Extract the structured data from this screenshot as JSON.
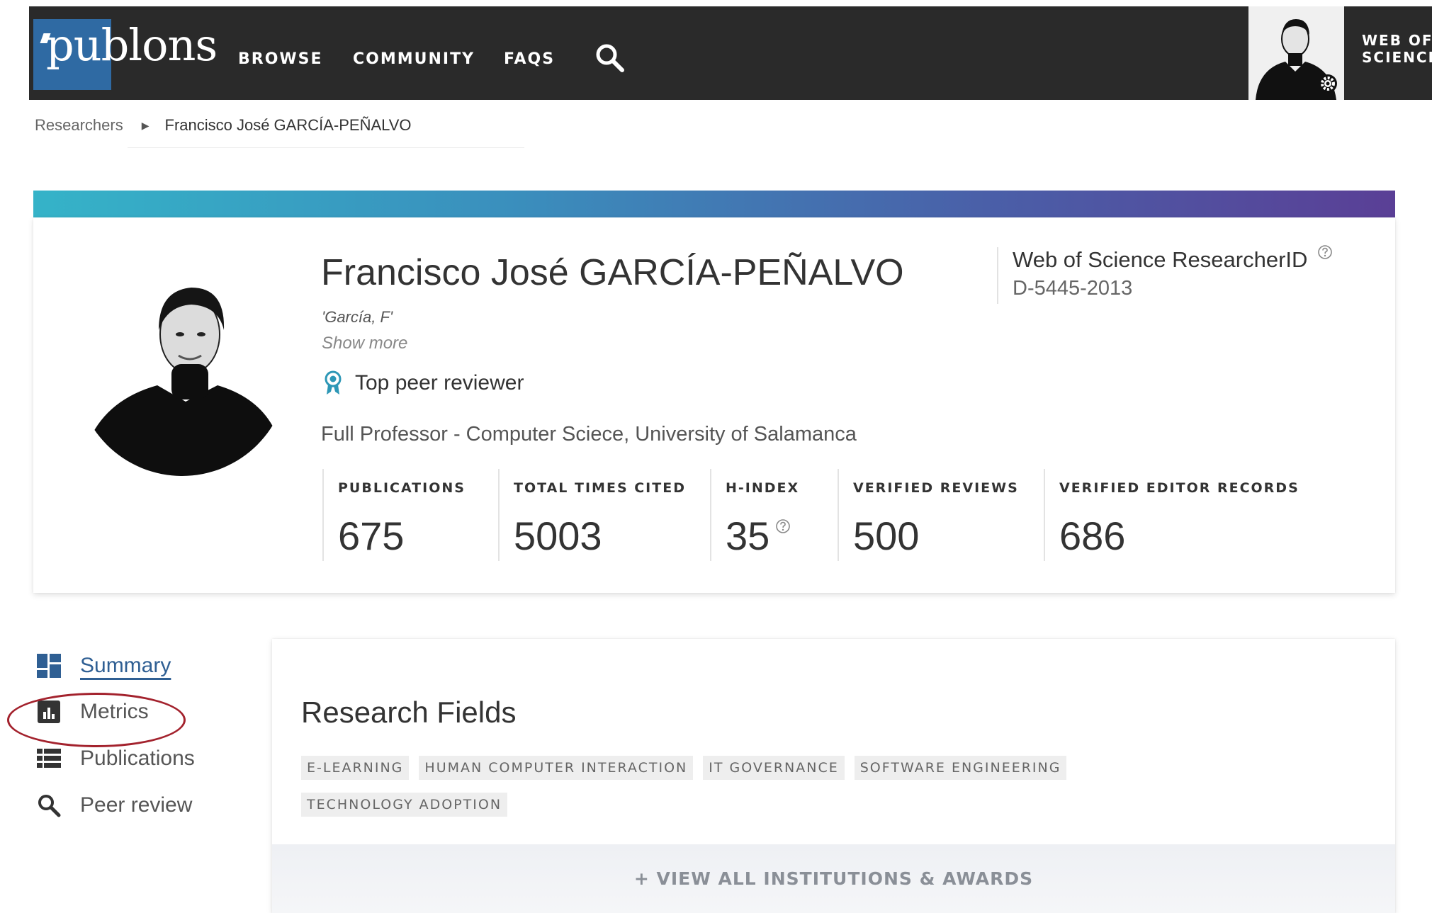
{
  "header": {
    "logo_text": "publons",
    "nav": [
      {
        "label": "BROWSE"
      },
      {
        "label": "COMMUNITY"
      },
      {
        "label": "FAQS"
      }
    ],
    "search_icon": "search-icon",
    "wos_link": {
      "line1": "WEB OF",
      "line2": "SCIENCE"
    }
  },
  "breadcrumb": {
    "root": "Researchers",
    "current": "Francisco José GARCÍA-PEÑALVO"
  },
  "profile": {
    "name": "Francisco José GARCÍA-PEÑALVO",
    "alias": "'García, F'",
    "show_more": "Show more",
    "badge": "Top peer reviewer",
    "position": "Full Professor - Computer Sciece, University of Salamanca",
    "researcher_id_title": "Web of Science ResearcherID",
    "researcher_id": "D-5445-2013",
    "metrics": [
      {
        "label": "PUBLICATIONS",
        "value": "675"
      },
      {
        "label": "TOTAL TIMES CITED",
        "value": "5003"
      },
      {
        "label": "H-INDEX",
        "value": "35"
      },
      {
        "label": "VERIFIED REVIEWS",
        "value": "500"
      },
      {
        "label": "VERIFIED EDITOR RECORDS",
        "value": "686"
      }
    ]
  },
  "sidebar": {
    "items": [
      {
        "label": "Summary",
        "icon": "dashboard-icon",
        "active": true
      },
      {
        "label": "Metrics",
        "icon": "bar-chart-icon",
        "highlighted": true
      },
      {
        "label": "Publications",
        "icon": "list-icon"
      },
      {
        "label": "Peer review",
        "icon": "search-icon"
      }
    ]
  },
  "research_fields": {
    "title": "Research Fields",
    "tags": [
      "E-LEARNING",
      "HUMAN COMPUTER INTERACTION",
      "IT GOVERNANCE",
      "SOFTWARE ENGINEERING",
      "TECHNOLOGY ADOPTION"
    ],
    "view_all": "+ VIEW ALL INSTITUTIONS & AWARDS"
  },
  "colors": {
    "topbar": "#2a2a2a",
    "logo_bg": "#2f6aa3",
    "gradient_start": "#35b3c8",
    "gradient_end": "#5a3f96",
    "active_link": "#2f5f93",
    "highlight_ring": "#a3222d"
  }
}
